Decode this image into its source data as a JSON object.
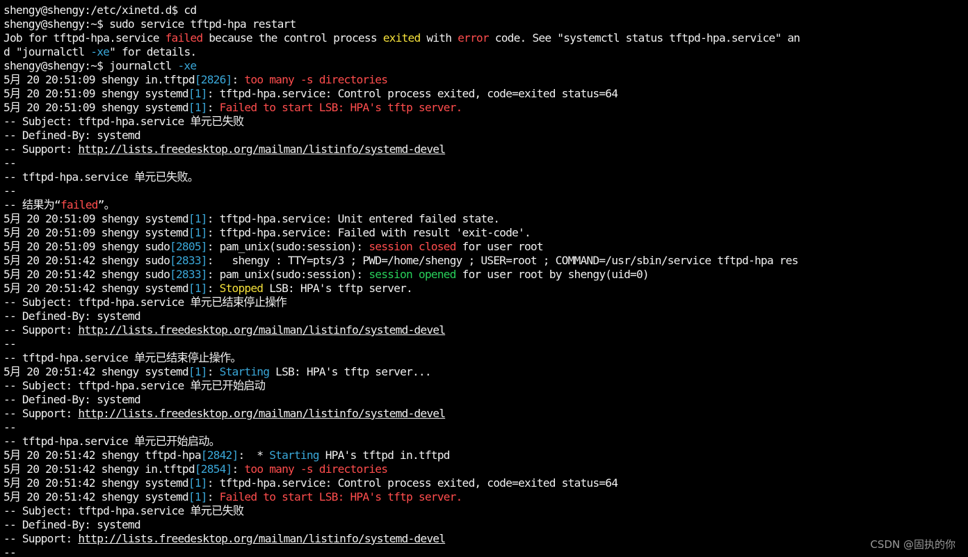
{
  "terminal": {
    "palette": {
      "background": "#000000",
      "default": "#f0f0f0",
      "red": "#ff4d4d",
      "yellow": "#f5e13b",
      "cyan": "#3aa7d8",
      "green": "#28d05a"
    },
    "lines": [
      [
        {
          "t": "shengy@shengy:/etc/xinetd.d$ cd"
        }
      ],
      [
        {
          "t": "shengy@shengy:~$ sudo service tftpd-hpa restart"
        }
      ],
      [
        {
          "t": "Job for tftpd-hpa.service "
        },
        {
          "t": "failed",
          "c": "red"
        },
        {
          "t": " because the control process "
        },
        {
          "t": "exited",
          "c": "yellow"
        },
        {
          "t": " with "
        },
        {
          "t": "error",
          "c": "red"
        },
        {
          "t": " code. See \"systemctl status tftpd-hpa.service\" an"
        }
      ],
      [
        {
          "t": "d \"journalctl "
        },
        {
          "t": "-xe",
          "c": "cyan"
        },
        {
          "t": "\" for details."
        }
      ],
      [
        {
          "t": "shengy@shengy:~$ journalctl "
        },
        {
          "t": "-xe",
          "c": "cyan"
        }
      ],
      [
        {
          "t": "5月 20 20:51:09 shengy in.tftpd"
        },
        {
          "t": "[2826]",
          "c": "cyan"
        },
        {
          "t": ": "
        },
        {
          "t": "too many -s directories",
          "c": "red"
        }
      ],
      [
        {
          "t": "5月 20 20:51:09 shengy systemd"
        },
        {
          "t": "[1]",
          "c": "cyan"
        },
        {
          "t": ": tftpd-hpa.service: Control process exited, code=exited status=64"
        }
      ],
      [
        {
          "t": "5月 20 20:51:09 shengy systemd"
        },
        {
          "t": "[1]",
          "c": "cyan"
        },
        {
          "t": ": "
        },
        {
          "t": "Failed to start LSB: HPA's tftp server.",
          "c": "red"
        }
      ],
      [
        {
          "t": "-- Subject: tftpd-hpa.service 单元已失败"
        }
      ],
      [
        {
          "t": "-- Defined-By: systemd"
        }
      ],
      [
        {
          "t": "-- Support: "
        },
        {
          "t": "http://lists.freedesktop.org/mailman/listinfo/systemd-devel",
          "u": true
        }
      ],
      [
        {
          "t": "--"
        }
      ],
      [
        {
          "t": "-- tftpd-hpa.service 单元已失败。"
        }
      ],
      [
        {
          "t": "--"
        }
      ],
      [
        {
          "t": "-- 结果为“"
        },
        {
          "t": "failed",
          "c": "red"
        },
        {
          "t": "”。"
        }
      ],
      [
        {
          "t": "5月 20 20:51:09 shengy systemd"
        },
        {
          "t": "[1]",
          "c": "cyan"
        },
        {
          "t": ": tftpd-hpa.service: Unit entered failed state."
        }
      ],
      [
        {
          "t": "5月 20 20:51:09 shengy systemd"
        },
        {
          "t": "[1]",
          "c": "cyan"
        },
        {
          "t": ": tftpd-hpa.service: Failed with result 'exit-code'."
        }
      ],
      [
        {
          "t": "5月 20 20:51:09 shengy sudo"
        },
        {
          "t": "[2805]",
          "c": "cyan"
        },
        {
          "t": ": pam_unix(sudo:session): "
        },
        {
          "t": "session closed",
          "c": "red"
        },
        {
          "t": " for user root"
        }
      ],
      [
        {
          "t": "5月 20 20:51:42 shengy sudo"
        },
        {
          "t": "[2833]",
          "c": "cyan"
        },
        {
          "t": ":   shengy : TTY=pts/3 ; PWD=/home/shengy ; USER=root ; COMMAND=/usr/sbin/service tftpd-hpa res"
        }
      ],
      [
        {
          "t": "5月 20 20:51:42 shengy sudo"
        },
        {
          "t": "[2833]",
          "c": "cyan"
        },
        {
          "t": ": pam_unix(sudo:session): "
        },
        {
          "t": "session opened",
          "c": "green"
        },
        {
          "t": " for user root by shengy(uid=0)"
        }
      ],
      [
        {
          "t": "5月 20 20:51:42 shengy systemd"
        },
        {
          "t": "[1]",
          "c": "cyan"
        },
        {
          "t": ": "
        },
        {
          "t": "Stopped",
          "c": "yellow"
        },
        {
          "t": " LSB: HPA's tftp server."
        }
      ],
      [
        {
          "t": "-- Subject: tftpd-hpa.service 单元已结束停止操作"
        }
      ],
      [
        {
          "t": "-- Defined-By: systemd"
        }
      ],
      [
        {
          "t": "-- Support: "
        },
        {
          "t": "http://lists.freedesktop.org/mailman/listinfo/systemd-devel",
          "u": true
        }
      ],
      [
        {
          "t": "--"
        }
      ],
      [
        {
          "t": "-- tftpd-hpa.service 单元已结束停止操作。"
        }
      ],
      [
        {
          "t": "5月 20 20:51:42 shengy systemd"
        },
        {
          "t": "[1]",
          "c": "cyan"
        },
        {
          "t": ": "
        },
        {
          "t": "Starting",
          "c": "cyan"
        },
        {
          "t": " LSB: HPA's tftp server..."
        }
      ],
      [
        {
          "t": "-- Subject: tftpd-hpa.service 单元已开始启动"
        }
      ],
      [
        {
          "t": "-- Defined-By: systemd"
        }
      ],
      [
        {
          "t": "-- Support: "
        },
        {
          "t": "http://lists.freedesktop.org/mailman/listinfo/systemd-devel",
          "u": true
        }
      ],
      [
        {
          "t": "--"
        }
      ],
      [
        {
          "t": "-- tftpd-hpa.service 单元已开始启动。"
        }
      ],
      [
        {
          "t": "5月 20 20:51:42 shengy tftpd-hpa"
        },
        {
          "t": "[2842]",
          "c": "cyan"
        },
        {
          "t": ":  * "
        },
        {
          "t": "Starting",
          "c": "cyan"
        },
        {
          "t": " HPA's tftpd in.tftpd"
        }
      ],
      [
        {
          "t": "5月 20 20:51:42 shengy in.tftpd"
        },
        {
          "t": "[2854]",
          "c": "cyan"
        },
        {
          "t": ": "
        },
        {
          "t": "too many -s directories",
          "c": "red"
        }
      ],
      [
        {
          "t": "5月 20 20:51:42 shengy systemd"
        },
        {
          "t": "[1]",
          "c": "cyan"
        },
        {
          "t": ": tftpd-hpa.service: Control process exited, code=exited status=64"
        }
      ],
      [
        {
          "t": "5月 20 20:51:42 shengy systemd"
        },
        {
          "t": "[1]",
          "c": "cyan"
        },
        {
          "t": ": "
        },
        {
          "t": "Failed to start LSB: HPA's tftp server.",
          "c": "red"
        }
      ],
      [
        {
          "t": "-- Subject: tftpd-hpa.service 单元已失败"
        }
      ],
      [
        {
          "t": "-- Defined-By: systemd"
        }
      ],
      [
        {
          "t": "-- Support: "
        },
        {
          "t": "http://lists.freedesktop.org/mailman/listinfo/systemd-devel",
          "u": true
        }
      ],
      [
        {
          "t": "--"
        }
      ]
    ]
  },
  "watermark": "CSDN @固执的你"
}
